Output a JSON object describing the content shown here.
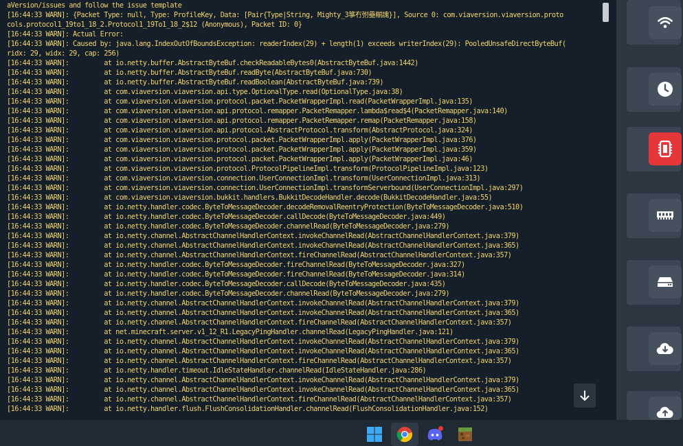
{
  "console": {
    "lines": [
      "aVersion/issues and follow the issue template",
      "[16:44:33 WARN]: {Packet Type: null, Type: ProfileKey, Data: [Pair{Type|String, Mighty_3箏冇弣壘糋謉}], Source 0: com.viaversion.viaversion.proto",
      "cols.protocol1_19to1_18_2.Protocol1_19To1_18_2$12 (Anonymous), Packet ID: 0}",
      "[16:44:33 WARN]: Actual Error:",
      "[16:44:33 WARN]: Caused by: java.lang.IndexOutOfBoundsException: readerIndex(29) + length(1) exceeds writerIndex(29): PooledUnsafeDirectByteBuf(",
      "ridx: 29, widx: 29, cap: 256)",
      "[16:44:33 WARN]:         at io.netty.buffer.AbstractByteBuf.checkReadableBytes0(AbstractByteBuf.java:1442)",
      "[16:44:33 WARN]:         at io.netty.buffer.AbstractByteBuf.readByte(AbstractByteBuf.java:730)",
      "[16:44:33 WARN]:         at io.netty.buffer.AbstractByteBuf.readBoolean(AbstractByteBuf.java:739)",
      "[16:44:33 WARN]:         at com.viaversion.viaversion.api.type.OptionalType.read(OptionalType.java:38)",
      "[16:44:33 WARN]:         at com.viaversion.viaversion.protocol.packet.PacketWrapperImpl.read(PacketWrapperImpl.java:135)",
      "[16:44:33 WARN]:         at com.viaversion.viaversion.api.protocol.remapper.PacketRemapper.lambda$read$4(PacketRemapper.java:140)",
      "[16:44:33 WARN]:         at com.viaversion.viaversion.api.protocol.remapper.PacketRemapper.remap(PacketRemapper.java:158)",
      "[16:44:33 WARN]:         at com.viaversion.viaversion.api.protocol.AbstractProtocol.transform(AbstractProtocol.java:324)",
      "[16:44:33 WARN]:         at com.viaversion.viaversion.protocol.packet.PacketWrapperImpl.apply(PacketWrapperImpl.java:376)",
      "[16:44:33 WARN]:         at com.viaversion.viaversion.protocol.packet.PacketWrapperImpl.apply(PacketWrapperImpl.java:359)",
      "[16:44:33 WARN]:         at com.viaversion.viaversion.protocol.packet.PacketWrapperImpl.apply(PacketWrapperImpl.java:46)",
      "[16:44:33 WARN]:         at com.viaversion.viaversion.protocol.ProtocolPipelineImpl.transform(ProtocolPipelineImpl.java:123)",
      "[16:44:33 WARN]:         at com.viaversion.viaversion.connection.UserConnectionImpl.transform(UserConnectionImpl.java:313)",
      "[16:44:33 WARN]:         at com.viaversion.viaversion.connection.UserConnectionImpl.transformServerbound(UserConnectionImpl.java:297)",
      "[16:44:33 WARN]:         at com.viaversion.viaversion.bukkit.handlers.BukkitDecodeHandler.decode(BukkitDecodeHandler.java:55)",
      "[16:44:33 WARN]:         at io.netty.handler.codec.ByteToMessageDecoder.decodeRemovalReentryProtection(ByteToMessageDecoder.java:510)",
      "[16:44:33 WARN]:         at io.netty.handler.codec.ByteToMessageDecoder.callDecode(ByteToMessageDecoder.java:449)",
      "[16:44:33 WARN]:         at io.netty.handler.codec.ByteToMessageDecoder.channelRead(ByteToMessageDecoder.java:279)",
      "[16:44:33 WARN]:         at io.netty.channel.AbstractChannelHandlerContext.invokeChannelRead(AbstractChannelHandlerContext.java:379)",
      "[16:44:33 WARN]:         at io.netty.channel.AbstractChannelHandlerContext.invokeChannelRead(AbstractChannelHandlerContext.java:365)",
      "[16:44:33 WARN]:         at io.netty.channel.AbstractChannelHandlerContext.fireChannelRead(AbstractChannelHandlerContext.java:357)",
      "[16:44:33 WARN]:         at io.netty.handler.codec.ByteToMessageDecoder.fireChannelRead(ByteToMessageDecoder.java:327)",
      "[16:44:33 WARN]:         at io.netty.handler.codec.ByteToMessageDecoder.fireChannelRead(ByteToMessageDecoder.java:314)",
      "[16:44:33 WARN]:         at io.netty.handler.codec.ByteToMessageDecoder.callDecode(ByteToMessageDecoder.java:435)",
      "[16:44:33 WARN]:         at io.netty.handler.codec.ByteToMessageDecoder.channelRead(ByteToMessageDecoder.java:279)",
      "[16:44:33 WARN]:         at io.netty.channel.AbstractChannelHandlerContext.invokeChannelRead(AbstractChannelHandlerContext.java:379)",
      "[16:44:33 WARN]:         at io.netty.channel.AbstractChannelHandlerContext.invokeChannelRead(AbstractChannelHandlerContext.java:365)",
      "[16:44:33 WARN]:         at io.netty.channel.AbstractChannelHandlerContext.fireChannelRead(AbstractChannelHandlerContext.java:357)",
      "[16:44:33 WARN]:         at net.minecraft.server.v1_12_R1.LegacyPingHandler.channelRead(LegacyPingHandler.java:121)",
      "[16:44:33 WARN]:         at io.netty.channel.AbstractChannelHandlerContext.invokeChannelRead(AbstractChannelHandlerContext.java:379)",
      "[16:44:33 WARN]:         at io.netty.channel.AbstractChannelHandlerContext.invokeChannelRead(AbstractChannelHandlerContext.java:365)",
      "[16:44:33 WARN]:         at io.netty.channel.AbstractChannelHandlerContext.fireChannelRead(AbstractChannelHandlerContext.java:357)",
      "[16:44:33 WARN]:         at io.netty.handler.timeout.IdleStateHandler.channelRead(IdleStateHandler.java:286)",
      "[16:44:33 WARN]:         at io.netty.channel.AbstractChannelHandlerContext.invokeChannelRead(AbstractChannelHandlerContext.java:379)",
      "[16:44:33 WARN]:         at io.netty.channel.AbstractChannelHandlerContext.invokeChannelRead(AbstractChannelHandlerContext.java:365)",
      "[16:44:33 WARN]:         at io.netty.channel.AbstractChannelHandlerContext.fireChannelRead(AbstractChannelHandlerContext.java:357)",
      "[16:44:33 WARN]:         at io.netty.handler.flush.FlushConsolidationHandler.channelRead(FlushConsolidationHandler.java:152)"
    ]
  },
  "sidebar": {
    "items": [
      {
        "icon": "wifi-icon",
        "active": false
      },
      {
        "icon": "clock-icon",
        "active": false
      },
      {
        "icon": "cpu-icon",
        "active": true
      },
      {
        "icon": "memory-icon",
        "active": false
      },
      {
        "icon": "storage-icon",
        "active": false
      },
      {
        "icon": "cloud-download-icon",
        "active": false
      },
      {
        "icon": "cloud-upload-icon",
        "active": false
      }
    ]
  },
  "colors": {
    "console_bg": "#151f29",
    "console_text": "#f3d46b",
    "sidebar_bg": "#2a3640",
    "active_accent": "#e5363a",
    "taskbar_bg": "#1f2a33"
  },
  "taskbar": {
    "apps": [
      {
        "icon": "windows-start-icon"
      },
      {
        "icon": "chrome-icon"
      },
      {
        "icon": "discord-icon"
      },
      {
        "icon": "minecraft-icon"
      }
    ]
  }
}
